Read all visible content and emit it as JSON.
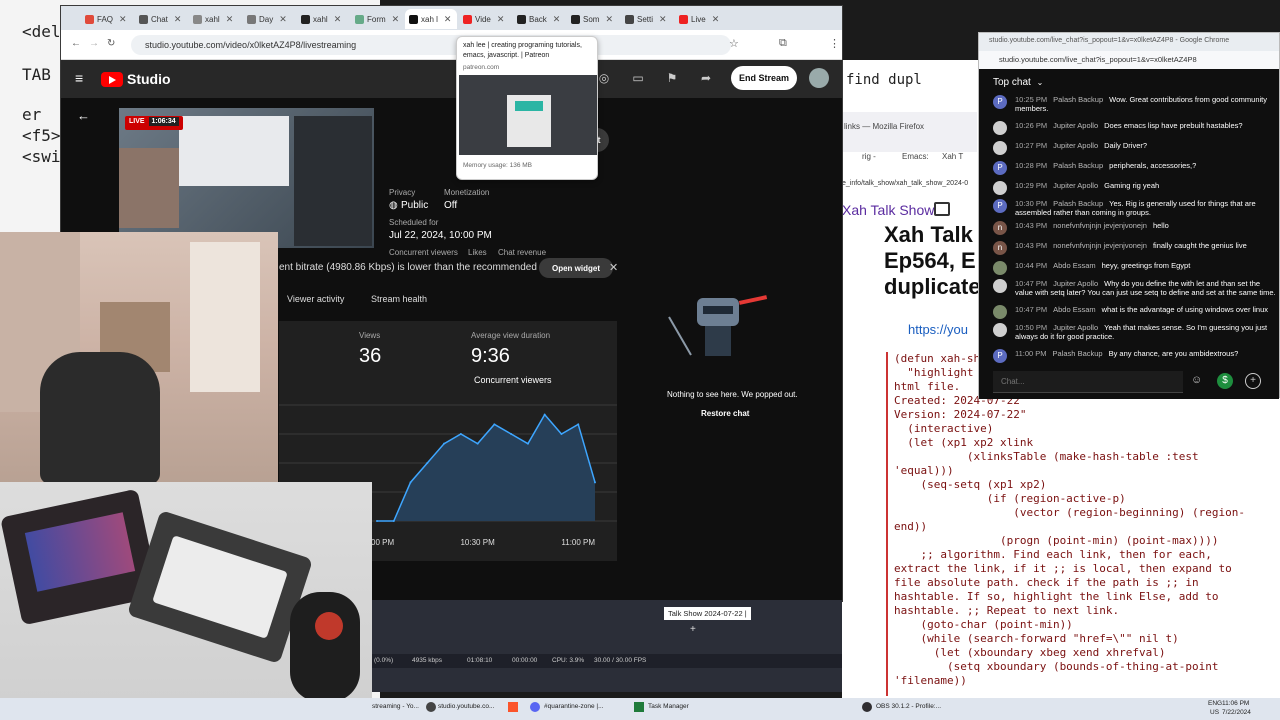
{
  "emacs_bg": {
    "lines": [
      "<del",
      "TAB",
      "er",
      "<f5>",
      "<swi"
    ]
  },
  "emacs_main": {
    "fragment_top": "find dupl",
    "heading": "Xah Talk Show",
    "title_lines": [
      "Xah Talk",
      "Ep564, E",
      "duplicate"
    ],
    "link_fragment": "https://you",
    "path_fragment": "e_info/talk_show/xah_talk_show_2024-0",
    "code": [
      "(defun xah-sh",
      "  \"highlight ",
      "html file.",
      "Created: 2024-07-22",
      "Version: 2024-07-22\"",
      "  (interactive)",
      "  (let (xp1 xp2 xlink",
      "           (xlinksTable (make-hash-table :test",
      "'equal)))",
      "    (seq-setq (xp1 xp2)",
      "              (if (region-active-p)",
      "                  (vector (region-beginning) (region-",
      "end))",
      "                (progn (point-min) (point-max))))",
      "    ;; algorithm. Find each link, then for each,",
      "extract the link, if it ;; is local, then expand to",
      "file absolute path. check if the path is ;; in",
      "hashtable. If so, highlight the link Else, add to",
      "hashtable. ;; Repeat to next link.",
      "    (goto-char (point-min))",
      "    (while (search-forward \"href=\\\"\" nil t)",
      "      (let (xboundary xbeg xend xhrefval)",
      "        (setq xboundary (bounds-of-thing-at-point",
      "'filename))"
    ]
  },
  "browser": {
    "tabs": [
      "FAQ",
      "Chat",
      "xahl",
      "Day",
      "xahl",
      "Form",
      "xah l",
      "Vide",
      "Back",
      "Som",
      "Setti",
      "Live"
    ],
    "url": "studio.youtube.com/video/x0lketAZ4P8/livestreaming",
    "studio_label": "Studio",
    "end_stream": "End Stream",
    "live_label": "LIVE",
    "live_time": "1:06:34",
    "edit_label": "Edit",
    "privacy_label": "Privacy",
    "privacy_value": "Public",
    "monetization_label": "Monetization",
    "monetization_value": "Off",
    "scheduled_label": "Scheduled for",
    "scheduled_value": "Jul 22, 2024, 10:00 PM",
    "meta_tabs": [
      "Concurrent viewers",
      "Likes",
      "Chat revenue"
    ],
    "warning": "ent bitrate (4980.86 Kbps) is lower than the recommended ...",
    "open_widget": "Open widget",
    "analytics_tabs": [
      "Viewer activity",
      "Stream health"
    ],
    "views_label": "Views",
    "views_value": "36",
    "avg_label": "Average view duration",
    "avg_value": "9:36",
    "concurrent_label": "Concurrent viewers",
    "chat_popped": "Nothing to see here. We popped out.",
    "restore_chat": "Restore chat",
    "tooltip_title": "xah lee | creating programing tutorials, emacs, javascript. | Patreon",
    "tooltip_domain": "patreon.com",
    "tooltip_memory": "Memory usage: 136 MB"
  },
  "chart_data": {
    "type": "area",
    "title": "",
    "x_ticks": [
      "10:00 PM",
      "10:30 PM",
      "11:00 PM"
    ],
    "x": [
      "10:00",
      "10:05",
      "10:10",
      "10:15",
      "10:20",
      "10:25",
      "10:30",
      "10:35",
      "10:40",
      "10:45",
      "10:50",
      "10:55",
      "11:00",
      "11:05"
    ],
    "values": [
      0,
      0,
      4,
      6,
      8,
      9,
      8,
      10,
      9,
      8,
      11,
      9,
      10,
      4
    ],
    "colors": {
      "line": "#3ea6ff",
      "fill": "#263f58"
    },
    "grid": true
  },
  "chat": {
    "window_title": "studio.youtube.com/live_chat?is_popout=1&v=x0lketAZ4P8 - Google Chrome",
    "url": "studio.youtube.com/live_chat?is_popout=1&v=x0lketAZ4P8",
    "header": "Top chat",
    "input_placeholder": "Chat...",
    "messages": [
      {
        "time": "10:25 PM",
        "author": "Palash Backup",
        "text": "Wow. Great contributions from good community members.",
        "avatar": "P",
        "color": "#5c6bc0"
      },
      {
        "time": "10:26 PM",
        "author": "Jupiter Apollo",
        "text": "Does emacs lisp have prebuilt hastables?",
        "avatar": "",
        "color": "#cfcfcf"
      },
      {
        "time": "10:27 PM",
        "author": "Jupiter Apollo",
        "text": "Daily Driver?",
        "avatar": "",
        "color": "#cfcfcf"
      },
      {
        "time": "10:28 PM",
        "author": "Palash Backup",
        "text": "peripherals, accessories,?",
        "avatar": "P",
        "color": "#5c6bc0"
      },
      {
        "time": "10:29 PM",
        "author": "Jupiter Apollo",
        "text": "Gaming rig yeah",
        "avatar": "",
        "color": "#cfcfcf"
      },
      {
        "time": "10:30 PM",
        "author": "Palash Backup",
        "text": "Yes. Rig is generally used for things that are assembled rather than coming in groups.",
        "avatar": "P",
        "color": "#5c6bc0"
      },
      {
        "time": "10:43 PM",
        "author": "nonefvnfvnjnjn jevjenjvonejn",
        "text": "hello",
        "avatar": "n",
        "color": "#795548"
      },
      {
        "time": "10:43 PM",
        "author": "nonefvnfvnjnjn jevjenjvonejn",
        "text": "finally caught the genius live",
        "avatar": "n",
        "color": "#795548"
      },
      {
        "time": "10:44 PM",
        "author": "Abdo Essam",
        "text": "heyy, greetings from Egypt",
        "avatar": "",
        "color": "#7a8a6a"
      },
      {
        "time": "10:47 PM",
        "author": "Jupiter Apollo",
        "text": "Why do you define the with let and than set the value with setq later? You can just use setq to define and set at the same time.",
        "avatar": "",
        "color": "#cfcfcf"
      },
      {
        "time": "10:47 PM",
        "author": "Abdo Essam",
        "text": "what is the advantage of using windows over linux",
        "avatar": "",
        "color": "#7a8a6a"
      },
      {
        "time": "10:50 PM",
        "author": "Jupiter Apollo",
        "text": "Yeah that makes sense. So I'm guessing you just always do it for good practice.",
        "avatar": "",
        "color": "#cfcfcf"
      },
      {
        "time": "11:00 PM",
        "author": "Palash Backup",
        "text": "By any chance, are you ambidextrous?",
        "avatar": "P",
        "color": "#5c6bc0"
      }
    ]
  },
  "firefox": {
    "title_fragment": "links — Mozilla Firefox",
    "tabs": [
      "rig -",
      "Emacs:",
      "Xah T"
    ]
  },
  "obs": {
    "stats": [
      "(0.0%)",
      "4935 kbps",
      "01:08:10",
      "00:00:00",
      "CPU: 3.9%",
      "30.00 / 30.00 FPS"
    ],
    "scene_label": "Talk Show 2024-07-22 |"
  },
  "taskbar": {
    "items": [
      "streaming - Yo...",
      "studio.youtube.co...",
      "#quarantine-zone |...",
      "Task Manager",
      "OBS 30.1.2 - Profile:..."
    ],
    "lang": "ENG",
    "region": "US",
    "time": "11:06 PM",
    "date": "7/22/2024"
  }
}
